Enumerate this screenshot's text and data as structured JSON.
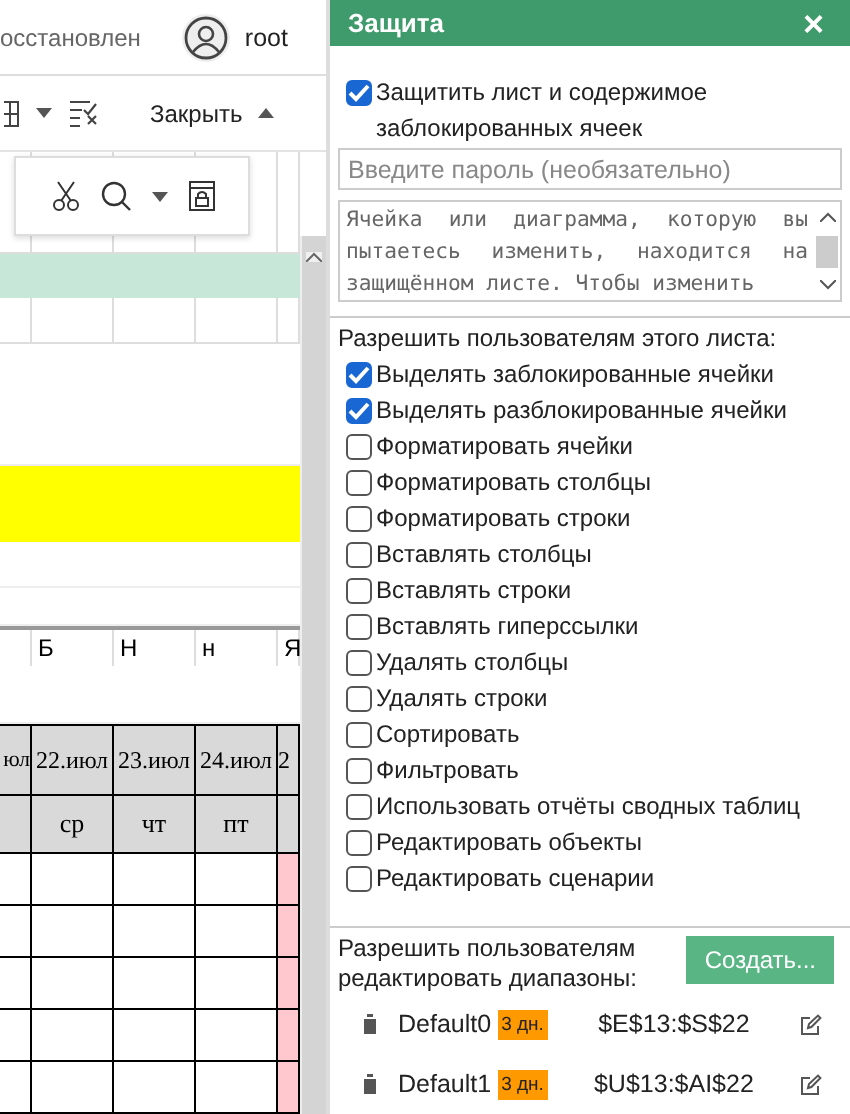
{
  "topbar": {
    "status": "осстановлен",
    "user": "root"
  },
  "toolbar": {
    "close_label": "Закрыть"
  },
  "sheet": {
    "letter_row": [
      "Б",
      "Н",
      "н",
      "Я"
    ],
    "date_row": [
      "юл",
      "22.июл",
      "23.июл",
      "24.июл",
      "2"
    ],
    "day_row": [
      "ср",
      "чт",
      "пт"
    ]
  },
  "panel": {
    "title": "Защита",
    "close": "×",
    "protect": {
      "label": "Защитить лист и содержимое заблокированных ячеек",
      "checked": true
    },
    "password": {
      "placeholder": "Введите пароль (необязательно)"
    },
    "message": "Ячейка или диаграмма, которую вы пытаетесь изменить, находится на защищённом листе. Чтобы изменить",
    "permissions_label": "Разрешить пользователям этого листа:",
    "permissions": [
      {
        "label": "Выделять заблокированные ячейки",
        "checked": true
      },
      {
        "label": "Выделять разблокированные ячейки",
        "checked": true
      },
      {
        "label": "Форматировать ячейки",
        "checked": false
      },
      {
        "label": "Форматировать столбцы",
        "checked": false
      },
      {
        "label": "Форматировать строки",
        "checked": false
      },
      {
        "label": "Вставлять столбцы",
        "checked": false
      },
      {
        "label": "Вставлять строки",
        "checked": false
      },
      {
        "label": "Вставлять гиперссылки",
        "checked": false
      },
      {
        "label": "Удалять столбцы",
        "checked": false
      },
      {
        "label": "Удалять строки",
        "checked": false
      },
      {
        "label": "Сортировать",
        "checked": false
      },
      {
        "label": "Фильтровать",
        "checked": false
      },
      {
        "label": "Использовать отчёты сводных таблиц",
        "checked": false
      },
      {
        "label": "Редактировать объекты",
        "checked": false
      },
      {
        "label": "Редактировать сценарии",
        "checked": false
      }
    ],
    "ranges_label": "Разрешить пользователям редактировать диапазоны:",
    "create_button": "Создать...",
    "ranges": [
      {
        "name": "Default0",
        "badge": "3 дн.",
        "ref": "$E$13:$S$22"
      },
      {
        "name": "Default1",
        "badge": "3 дн.",
        "ref": "$U$13:$AI$22"
      }
    ]
  }
}
